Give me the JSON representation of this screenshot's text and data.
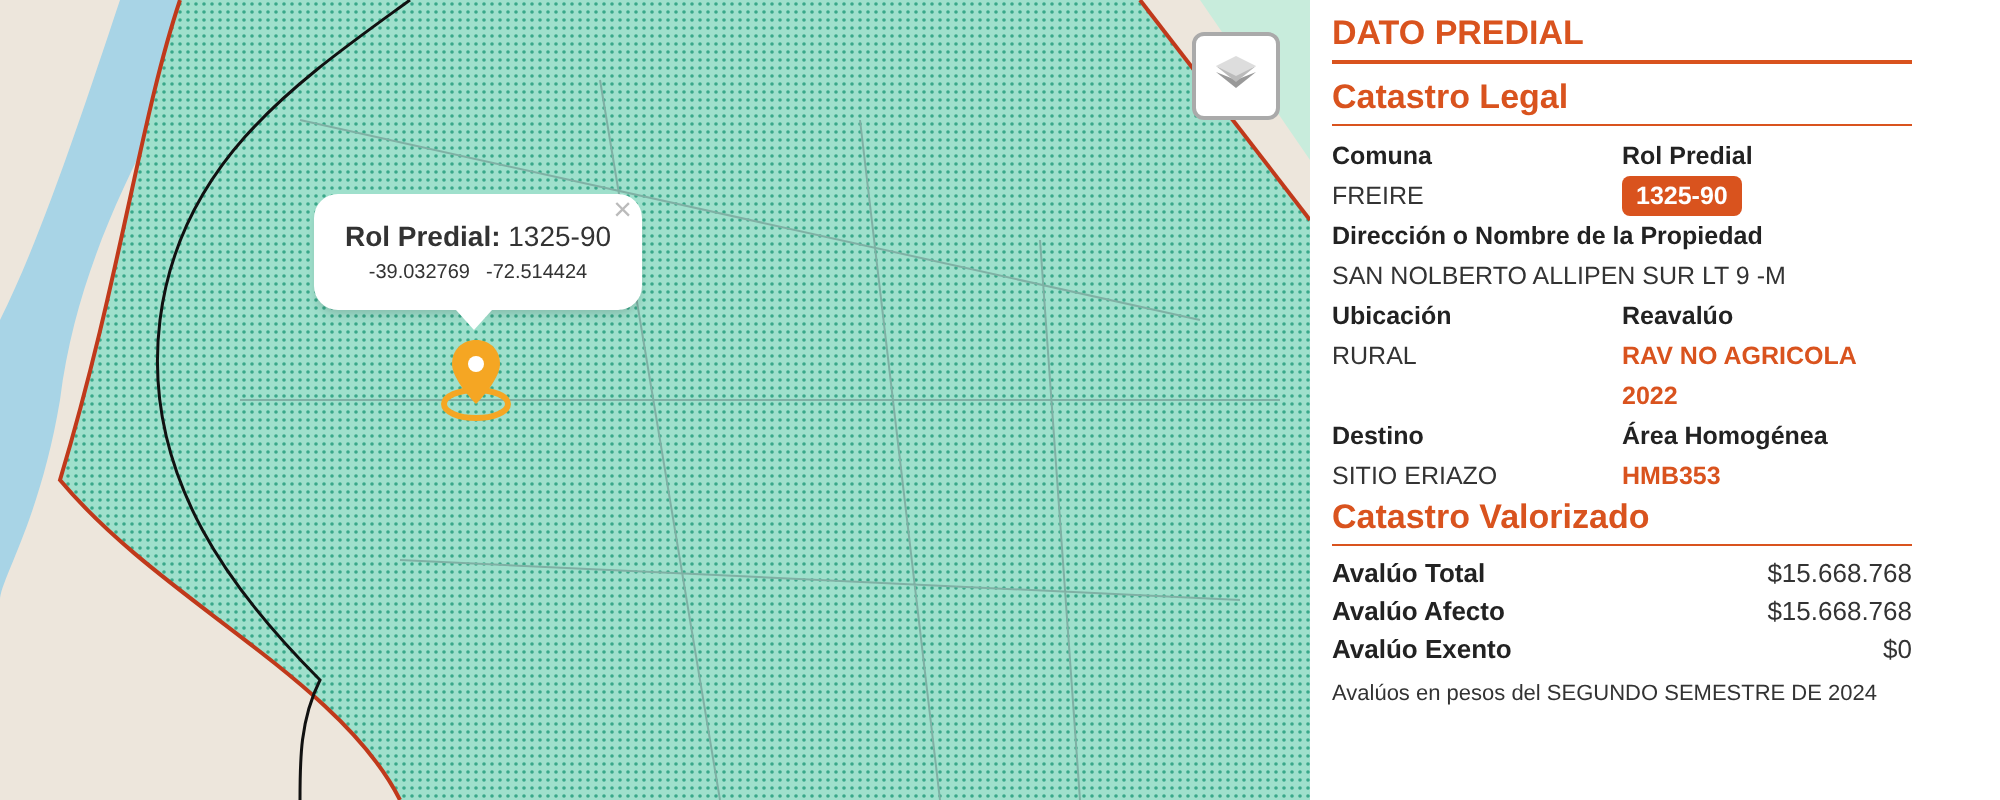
{
  "map": {
    "popup": {
      "title": "**Rol Predial:** 1325-90",
      "lat": "-39.032769",
      "lng": "-72.514424",
      "close": "×"
    }
  },
  "panel": {
    "title": "DATO PREDIAL",
    "legal": {
      "heading": "Catastro Legal",
      "fields": [
        {
          "label": "Comuna",
          "value": "FREIRE",
          "kind": "plain"
        },
        {
          "label": "Rol Predial",
          "value": "1325-90",
          "kind": "badge"
        },
        {
          "label": "Dirección o Nombre de la Propiedad",
          "value": "SAN NOLBERTO ALLIPEN SUR LT 9 -M",
          "kind": "wide"
        },
        {
          "label": "Ubicación",
          "value": "RURAL",
          "kind": "plain"
        },
        {
          "label": "Reavalúo",
          "value": "RAV NO AGRICOLA 2022",
          "kind": "accent"
        },
        {
          "label": "Destino",
          "value": "SITIO ERIAZO",
          "kind": "plain"
        },
        {
          "label": "Área Homogénea",
          "value": "HMB353",
          "kind": "accent"
        }
      ]
    },
    "valued": {
      "heading": "Catastro Valorizado",
      "rows": [
        {
          "label": "Avalúo Total",
          "value": "$15.668.768"
        },
        {
          "label": "Avalúo Afecto",
          "value": "$15.668.768"
        },
        {
          "label": "Avalúo Exento",
          "value": "$0"
        }
      ],
      "note": "Avalúos en pesos del SEGUNDO SEMESTRE DE 2024"
    }
  }
}
